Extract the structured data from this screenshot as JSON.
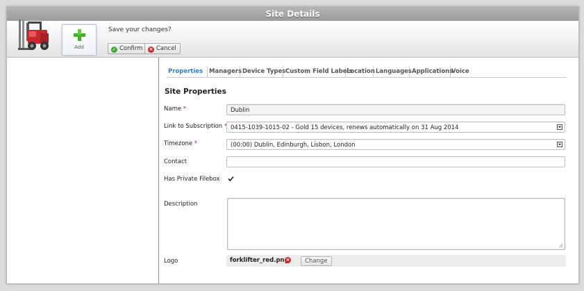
{
  "window": {
    "title": "Site Details"
  },
  "toolbar": {
    "add_label": "Add",
    "prompt": "Save your changes?",
    "confirm_label": "Confirm",
    "cancel_label": "Cancel"
  },
  "tabs": [
    "Properties",
    "Managers",
    "Device Types",
    "Custom Field Labels",
    "Location",
    "Languages",
    "Applications",
    "Voice"
  ],
  "active_tab": "Properties",
  "section_title": "Site Properties",
  "fields": {
    "name": {
      "label": "Name",
      "required_mark": "*",
      "value": "Dublin"
    },
    "subscription": {
      "label": "Link to Subscription",
      "required_mark": "*",
      "value": "0415-1039-1015-02 - Gold 15 devices, renews automatically on 31 Aug 2014"
    },
    "timezone": {
      "label": "Timezone",
      "required_mark": "*",
      "value": "(00:00) Dublin, Edinburgh, Lisbon, London"
    },
    "contact": {
      "label": "Contact",
      "value": ""
    },
    "private_filebox": {
      "label": "Has Private Filebox",
      "checked": true
    },
    "description": {
      "label": "Description",
      "value": ""
    },
    "logo": {
      "label": "Logo",
      "filename": "forklifter_red.png",
      "change_label": "Change"
    }
  },
  "colors": {
    "accent_tab": "#3a7bbf",
    "required": "#cc2222",
    "confirm_icon": "#3fa83a",
    "cancel_icon": "#c62c2c"
  },
  "icons": [
    "forklift-logo-icon",
    "plus-icon",
    "confirm-check-icon",
    "cancel-x-icon",
    "select-arrow-icon",
    "checkbox-check-icon",
    "remove-file-icon",
    "resize-grip-icon"
  ]
}
